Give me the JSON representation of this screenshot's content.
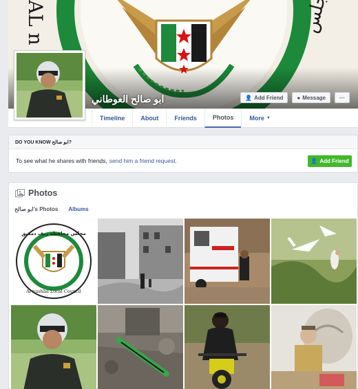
{
  "profile": {
    "name": "ابو صالح العوطاني"
  },
  "cover": {
    "logo_arabic_left": "AL n",
    "logo_arabic_right": "المجلس"
  },
  "cover_buttons": {
    "add_friend": "Add Friend",
    "message": "Message",
    "more": "···"
  },
  "nav": {
    "items": [
      "Timeline",
      "About",
      "Friends",
      "Photos",
      "More"
    ],
    "active": "Photos"
  },
  "know": {
    "heading": "DO YOU KNOW ابو صالح?",
    "text": "To see what he shares with friends,",
    "link": "send him a friend request.",
    "button": "Add Friend"
  },
  "photos": {
    "title": "Photos",
    "tab_own": "ابو صالح's Photos",
    "tab_albums": "Albums",
    "items": [
      "council-logo",
      "ruined-street",
      "ambulance",
      "storks",
      "soldier-profile",
      "rubble-missile",
      "motorcycle-rider",
      "portrait-collage"
    ],
    "logo_text_top": "مجلس محافظة ريف دمشق",
    "logo_text_bottom": "Al nushba Local Council"
  },
  "colors": {
    "accent": "#4267b2",
    "link": "#365899",
    "green_button": "#42b72a",
    "flag_green": "#1c8a3a"
  }
}
